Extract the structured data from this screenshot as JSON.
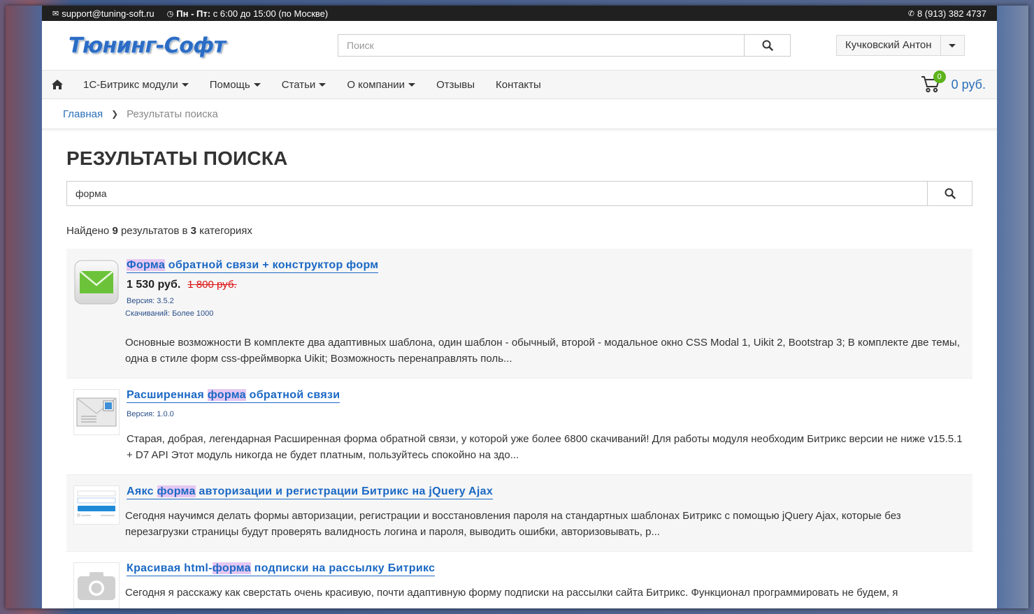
{
  "topbar": {
    "email": "support@tuning-soft.ru",
    "hours_bold": "Пн - Пт:",
    "hours": "с 6:00 до 15:00 (по Москве)",
    "phone": "8 (913) 382 4737"
  },
  "header": {
    "logo": "Тюнинг-Софт",
    "search_placeholder": "Поиск",
    "user_name": "Кучковский Антон"
  },
  "nav": {
    "items": [
      {
        "label": "1С-Битрикс модули",
        "has_dropdown": true
      },
      {
        "label": "Помощь",
        "has_dropdown": true
      },
      {
        "label": "Статьи",
        "has_dropdown": true
      },
      {
        "label": "О компании",
        "has_dropdown": true
      },
      {
        "label": "Отзывы",
        "has_dropdown": false
      },
      {
        "label": "Контакты",
        "has_dropdown": false
      }
    ],
    "cart_count": "0",
    "cart_sum": "0 руб."
  },
  "breadcrumb": {
    "home": "Главная",
    "current": "Результаты поиска"
  },
  "main": {
    "title": "РЕЗУЛЬТАТЫ ПОИСКА",
    "query": "форма",
    "found_prefix": "Найдено",
    "found_count": "9",
    "found_mid": "результатов в",
    "found_cats": "3",
    "found_suffix": "категориях"
  },
  "results": [
    {
      "title_pre": "",
      "title_hl": "Форма",
      "title_post": " обратной связи + конструктор форм",
      "price": "1 530 руб.",
      "old_price": "1 800 руб.",
      "version": "Версия: 3.5.2",
      "downloads": "Скачиваний: Более 1000",
      "desc": "Основные возможности В комплекте два адаптивных шаблона, один шаблон - обычный, второй - модальное окно CSS Modal 1, Uikit 2, Bootstrap 3; В комплекте две темы, одна в стиле форм css-фреймворка Uikit; Возможность перенаправлять поль..."
    },
    {
      "title_pre": "Расширенная ",
      "title_hl": "форма",
      "title_post": " обратной связи",
      "version": "Версия: 1.0.0",
      "desc": "Старая, добрая, легендарная Расширенная форма обратной связи, у которой уже более 6800 скачиваний! Для работы модуля необходим Битрикс версии не ниже v15.5.1 + D7 API Этот модуль никогда не будет платным, пользуйтесь спокойно на здо..."
    },
    {
      "title_pre": "Аякс ",
      "title_hl": "форма",
      "title_post": " авторизации и регистрации Битрикс на jQuery Ajax",
      "desc": "Сегодня научимся делать формы авторизации, регистрации и восстановления пароля на стандартных шаблонах Битрикс с помощью jQuery Ajax, которые без перезагрузки страницы будут проверять валидность логина и пароля, выводить ошибки, авторизовывать, р..."
    },
    {
      "title_pre": "Красивая html-",
      "title_hl": "форма",
      "title_post": " подписки на рассылку Битрикс",
      "desc": "Сегодня я расскажу как сверстать очень красивую, почти адаптивную форму подписки на рассылки сайта Битрикс. Функционал программировать не будем, я"
    }
  ],
  "colors": {
    "link": "#1a68c4",
    "highlight": "#e5c7f2",
    "badge": "#5cb31a",
    "old_price": "#dd1111"
  }
}
